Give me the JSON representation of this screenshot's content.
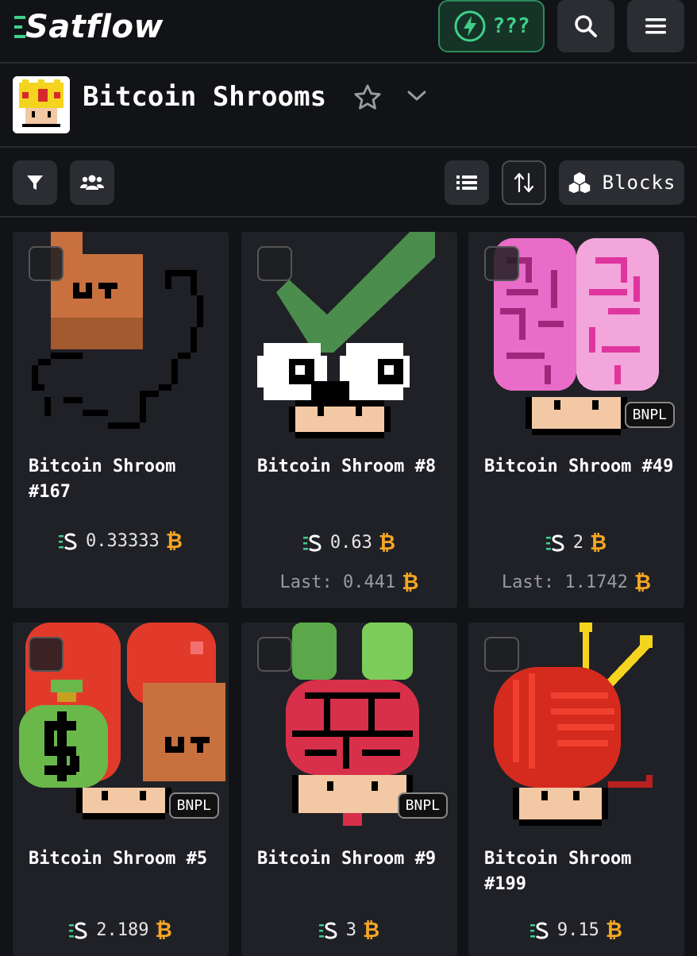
{
  "header": {
    "brand": "Satflow",
    "lightning_label": "???"
  },
  "collection": {
    "title": "Bitcoin Shrooms"
  },
  "toolbar": {
    "blocks_label": "Blocks"
  },
  "cards": [
    {
      "name": "Bitcoin Shroom #167",
      "price": "0.33333",
      "last": "",
      "bnpl": ""
    },
    {
      "name": "Bitcoin Shroom #8",
      "price": "0.63",
      "last": "Last: 0.441",
      "bnpl": ""
    },
    {
      "name": "Bitcoin Shroom #49",
      "price": "2",
      "last": "Last: 1.1742",
      "bnpl": "BNPL"
    },
    {
      "name": "Bitcoin Shroom #5",
      "price": "2.189",
      "last": "",
      "bnpl": "BNPL"
    },
    {
      "name": "Bitcoin Shroom #9",
      "price": "3",
      "last": "",
      "bnpl": "BNPL"
    },
    {
      "name": "Bitcoin Shroom #199",
      "price": "9.15",
      "last": "",
      "bnpl": ""
    }
  ],
  "currency_symbol": "₿",
  "colors": {
    "accent": "#3fd08a",
    "btc": "#f5a623",
    "bg": "#121316",
    "card": "#202126"
  },
  "icons": [
    "lightning-icon",
    "search-icon",
    "menu-icon",
    "star-icon",
    "chevron-down-icon",
    "filter-icon",
    "users-icon",
    "list-icon",
    "sort-icon",
    "blocks-icon",
    "satflow-s-icon"
  ]
}
